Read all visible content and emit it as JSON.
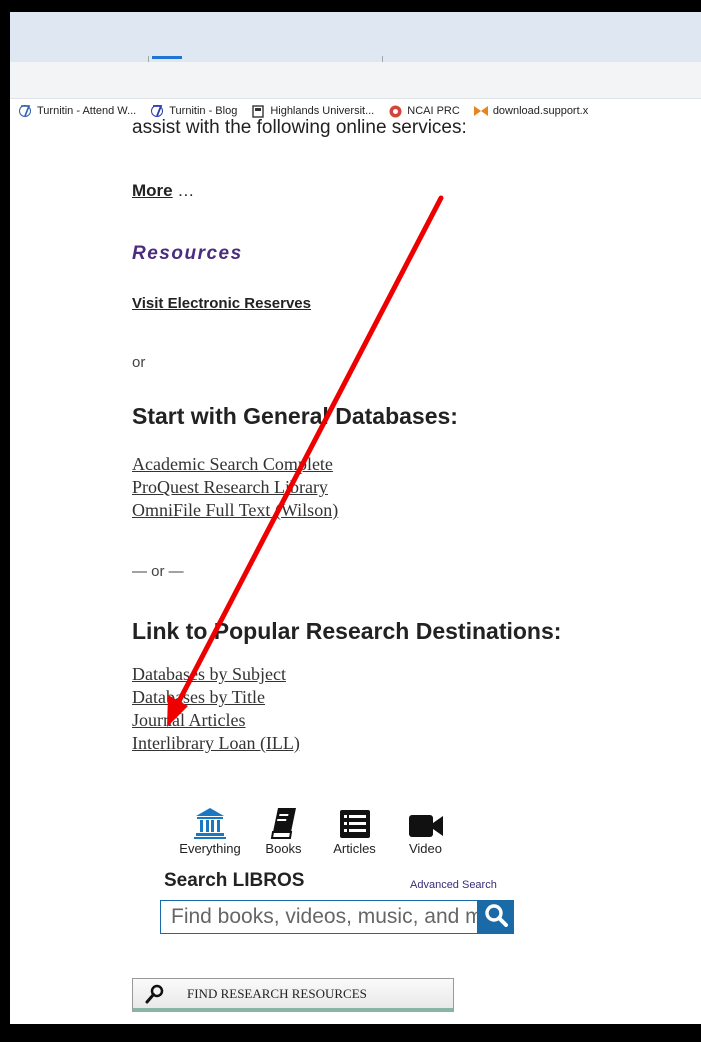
{
  "bookmarks": [
    {
      "label": "Turnitin - Attend W...",
      "icon": "turnitin-icon"
    },
    {
      "label": "Turnitin - Blog",
      "icon": "turnitin-icon"
    },
    {
      "label": "Highlands Universit...",
      "icon": "bookmark-page-icon"
    },
    {
      "label": "NCAI PRC",
      "icon": "ncai-icon"
    },
    {
      "label": "download.support.x",
      "icon": "download-support-icon"
    }
  ],
  "page": {
    "cutoff_text": "assist with the following online services:",
    "more_link": "More",
    "more_suffix": " …",
    "resources_heading": "Resources",
    "reserves_link": "Visit Electronic Reserves ",
    "or_1": "or",
    "general_heading": "Start with General Databases:",
    "general_links": [
      "Academic Search Complete",
      "ProQuest Research Library",
      "OmniFile Full Text (Wilson)"
    ],
    "or_2": "— or —",
    "popular_heading": "Link to Popular Research Destinations:",
    "popular_links": [
      "Databases by Subject",
      "Databases by Title",
      "Journal Articles",
      "Interlibrary Loan (ILL)"
    ]
  },
  "search": {
    "tabs": [
      {
        "label": "Everything",
        "icon": "library-building-icon",
        "active": true
      },
      {
        "label": "Books",
        "icon": "book-icon",
        "active": false
      },
      {
        "label": "Articles",
        "icon": "article-list-icon",
        "active": false
      },
      {
        "label": "Video",
        "icon": "video-camera-icon",
        "active": false
      }
    ],
    "title": "Search LIBROS",
    "advanced_link": "Advanced Search",
    "placeholder": "Find books, videos, music, and more",
    "button_icon": "search-icon"
  },
  "find_button": {
    "label": "FIND RESEARCH RESOURCES",
    "icon": "magnifier-icon"
  },
  "annotation": {
    "color": "#ee0000",
    "points_to": "Journal Articles"
  },
  "colors": {
    "accent": "#1a6aa8",
    "heading_purple": "#4b2c7f",
    "tab_strip": "#dfe8f2"
  }
}
